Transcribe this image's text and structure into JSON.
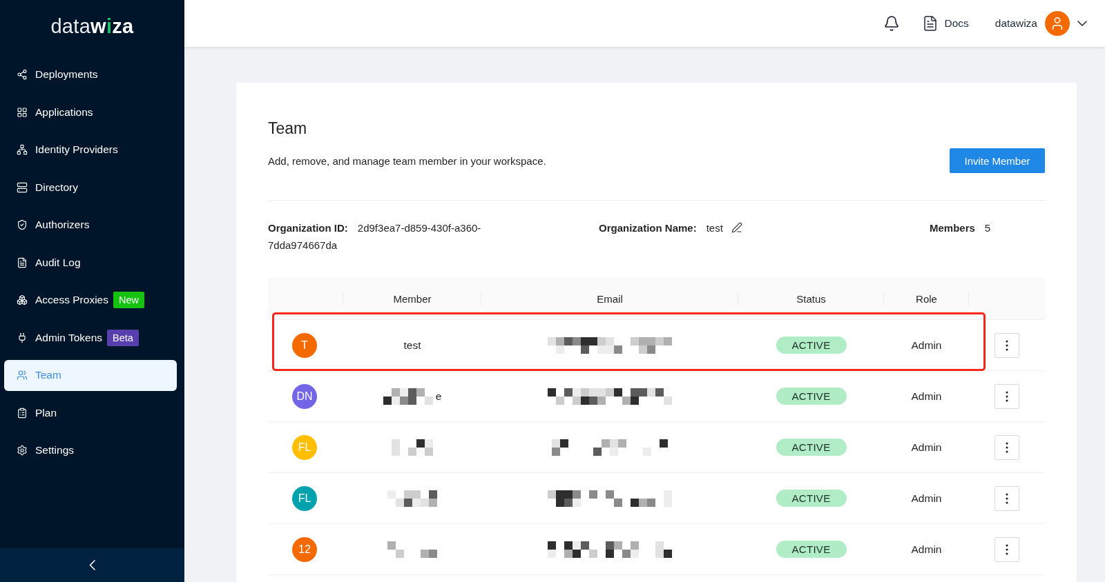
{
  "sidebar": {
    "logo": {
      "parts": [
        {
          "text": "data",
          "kind": "light"
        },
        {
          "text": "w",
          "kind": "bold"
        },
        {
          "text": "i",
          "kind": "accent"
        },
        {
          "text": "za",
          "kind": "bold"
        }
      ]
    },
    "items": [
      {
        "label": "Deployments",
        "selected": false
      },
      {
        "label": "Applications",
        "selected": false
      },
      {
        "label": "Identity Providers",
        "selected": false
      },
      {
        "label": "Directory",
        "selected": false
      },
      {
        "label": "Authorizers",
        "selected": false
      },
      {
        "label": "Audit Log",
        "selected": false
      },
      {
        "label": "Access Proxies",
        "selected": false,
        "badge": {
          "text": "New",
          "color": "#14c20f"
        }
      },
      {
        "label": "Admin Tokens",
        "selected": false,
        "badge": {
          "text": "Beta",
          "color": "#5740ae"
        }
      },
      {
        "label": "Team",
        "selected": true
      },
      {
        "label": "Plan",
        "selected": false
      },
      {
        "label": "Settings",
        "selected": false
      }
    ]
  },
  "top_bar": {
    "docs_label": "Docs",
    "user_name": "datawiza"
  },
  "page": {
    "title": "Team",
    "description": "Add, remove, and manage team member in your workspace.",
    "invite_button": "Invite Member",
    "organization": {
      "id_label": "Organization ID:",
      "id": "2d9f3ea7-d859-430f-a360-7dda974667da",
      "name_label": "Organization Name:",
      "name": "test",
      "members_label": "Members",
      "members": "5"
    }
  },
  "table": {
    "columns": [
      "Member",
      "Email",
      "Status",
      "Role"
    ],
    "rows": [
      {
        "initials": "T",
        "color": "#f56a00",
        "member": "test",
        "member_redacted": false,
        "email_redacted": true,
        "status": "ACTIVE",
        "role": "Admin",
        "highlighted": true
      },
      {
        "initials": "DN",
        "color": "#7265e6",
        "member": "e",
        "member_redacted": true,
        "email_redacted": true,
        "status": "ACTIVE",
        "role": "Admin",
        "highlighted": false
      },
      {
        "initials": "FL",
        "color": "#ffbf00",
        "member_redacted": true,
        "email_redacted": true,
        "status": "ACTIVE",
        "role": "Admin",
        "highlighted": false
      },
      {
        "initials": "FL",
        "color": "#00a2ae",
        "member_redacted": true,
        "email_redacted": true,
        "status": "ACTIVE",
        "role": "Admin",
        "highlighted": false
      },
      {
        "initials": "12",
        "color": "#f56a00",
        "member_redacted": true,
        "email_redacted": true,
        "status": "ACTIVE",
        "role": "Admin",
        "highlighted": false
      }
    ]
  }
}
